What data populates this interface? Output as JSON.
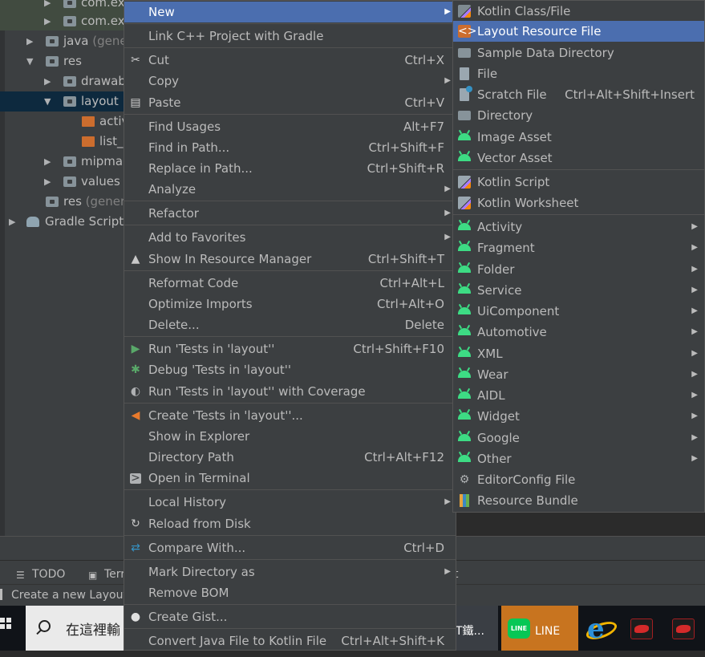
{
  "tree": {
    "items": [
      {
        "label": "com.exa",
        "hint": ""
      },
      {
        "label": "com.exa",
        "hint": ""
      },
      {
        "label": "java",
        "hint": "(gener"
      },
      {
        "label": "res",
        "hint": ""
      },
      {
        "label": "drawab",
        "hint": ""
      },
      {
        "label": "layout",
        "hint": ""
      },
      {
        "label": "activ",
        "hint": ""
      },
      {
        "label": "list_c",
        "hint": ""
      },
      {
        "label": "mipmap",
        "hint": ""
      },
      {
        "label": "values",
        "hint": ""
      },
      {
        "label": "res",
        "hint": "(genera"
      },
      {
        "label": "Gradle Scripts",
        "hint": ""
      }
    ]
  },
  "toolwindows": {
    "todo": "TODO",
    "terminal": "Terr",
    "right_fragment": "t"
  },
  "status": {
    "text": "Create a new Layout"
  },
  "taskbar": {
    "search_placeholder": "在這裡輸",
    "apps": [
      {
        "label": "T鐵..."
      },
      {
        "label": "LINE"
      }
    ]
  },
  "context_menu": {
    "items": [
      {
        "label": "New",
        "shortcut": "",
        "submenu": true,
        "icon": ""
      },
      {
        "label": "Link C++ Project with Gradle",
        "shortcut": "",
        "submenu": false,
        "icon": ""
      },
      {
        "label": "Cut",
        "shortcut": "Ctrl+X",
        "submenu": false,
        "icon": "scissors-icon"
      },
      {
        "label": "Copy",
        "shortcut": "",
        "submenu": true,
        "icon": ""
      },
      {
        "label": "Paste",
        "shortcut": "Ctrl+V",
        "submenu": false,
        "icon": "clipboard-icon"
      },
      {
        "label": "Find Usages",
        "shortcut": "Alt+F7",
        "submenu": false,
        "icon": ""
      },
      {
        "label": "Find in Path...",
        "shortcut": "Ctrl+Shift+F",
        "submenu": false,
        "icon": ""
      },
      {
        "label": "Replace in Path...",
        "shortcut": "Ctrl+Shift+R",
        "submenu": false,
        "icon": ""
      },
      {
        "label": "Analyze",
        "shortcut": "",
        "submenu": true,
        "icon": ""
      },
      {
        "label": "Refactor",
        "shortcut": "",
        "submenu": true,
        "icon": ""
      },
      {
        "label": "Add to Favorites",
        "shortcut": "",
        "submenu": true,
        "icon": ""
      },
      {
        "label": "Show In Resource Manager",
        "shortcut": "Ctrl+Shift+T",
        "submenu": false,
        "icon": "resource-manager-icon"
      },
      {
        "label": "Reformat Code",
        "shortcut": "Ctrl+Alt+L",
        "submenu": false,
        "icon": ""
      },
      {
        "label": "Optimize Imports",
        "shortcut": "Ctrl+Alt+O",
        "submenu": false,
        "icon": ""
      },
      {
        "label": "Delete...",
        "shortcut": "Delete",
        "submenu": false,
        "icon": ""
      },
      {
        "label": "Run 'Tests in 'layout''",
        "shortcut": "Ctrl+Shift+F10",
        "submenu": false,
        "icon": "run-icon"
      },
      {
        "label": "Debug 'Tests in 'layout''",
        "shortcut": "",
        "submenu": false,
        "icon": "debug-icon"
      },
      {
        "label": "Run 'Tests in 'layout'' with Coverage",
        "shortcut": "",
        "submenu": false,
        "icon": "coverage-icon"
      },
      {
        "label": "Create 'Tests in 'layout''...",
        "shortcut": "",
        "submenu": false,
        "icon": "create-test-icon"
      },
      {
        "label": "Show in Explorer",
        "shortcut": "",
        "submenu": false,
        "icon": ""
      },
      {
        "label": "Directory Path",
        "shortcut": "Ctrl+Alt+F12",
        "submenu": false,
        "icon": ""
      },
      {
        "label": "Open in Terminal",
        "shortcut": "",
        "submenu": false,
        "icon": "terminal-icon"
      },
      {
        "label": "Local History",
        "shortcut": "",
        "submenu": true,
        "icon": ""
      },
      {
        "label": "Reload from Disk",
        "shortcut": "",
        "submenu": false,
        "icon": "reload-icon"
      },
      {
        "label": "Compare With...",
        "shortcut": "Ctrl+D",
        "submenu": false,
        "icon": "compare-icon"
      },
      {
        "label": "Mark Directory as",
        "shortcut": "",
        "submenu": true,
        "icon": ""
      },
      {
        "label": "Remove BOM",
        "shortcut": "",
        "submenu": false,
        "icon": ""
      },
      {
        "label": "Create Gist...",
        "shortcut": "",
        "submenu": false,
        "icon": "github-icon"
      },
      {
        "label": "Convert Java File to Kotlin File",
        "shortcut": "Ctrl+Alt+Shift+K",
        "submenu": false,
        "icon": ""
      }
    ]
  },
  "new_submenu": {
    "items": [
      {
        "label": "Kotlin Class/File",
        "shortcut": "",
        "submenu": false,
        "icon": "kotlin-file-icon"
      },
      {
        "label": "Layout Resource File",
        "shortcut": "",
        "submenu": false,
        "icon": "layout-file-icon"
      },
      {
        "label": "Sample Data Directory",
        "shortcut": "",
        "submenu": false,
        "icon": "folder-icon"
      },
      {
        "label": "File",
        "shortcut": "",
        "submenu": false,
        "icon": "file-icon"
      },
      {
        "label": "Scratch File",
        "shortcut": "Ctrl+Alt+Shift+Insert",
        "submenu": false,
        "icon": "scratch-file-icon"
      },
      {
        "label": "Directory",
        "shortcut": "",
        "submenu": false,
        "icon": "folder-icon"
      },
      {
        "label": "Image Asset",
        "shortcut": "",
        "submenu": false,
        "icon": "android-icon"
      },
      {
        "label": "Vector Asset",
        "shortcut": "",
        "submenu": false,
        "icon": "android-icon"
      },
      {
        "label": "Kotlin Script",
        "shortcut": "",
        "submenu": false,
        "icon": "kotlin-script-icon"
      },
      {
        "label": "Kotlin Worksheet",
        "shortcut": "",
        "submenu": false,
        "icon": "kotlin-script-icon"
      },
      {
        "label": "Activity",
        "shortcut": "",
        "submenu": true,
        "icon": "android-icon"
      },
      {
        "label": "Fragment",
        "shortcut": "",
        "submenu": true,
        "icon": "android-icon"
      },
      {
        "label": "Folder",
        "shortcut": "",
        "submenu": true,
        "icon": "android-icon"
      },
      {
        "label": "Service",
        "shortcut": "",
        "submenu": true,
        "icon": "android-icon"
      },
      {
        "label": "UiComponent",
        "shortcut": "",
        "submenu": true,
        "icon": "android-icon"
      },
      {
        "label": "Automotive",
        "shortcut": "",
        "submenu": true,
        "icon": "android-icon"
      },
      {
        "label": "XML",
        "shortcut": "",
        "submenu": true,
        "icon": "android-icon"
      },
      {
        "label": "Wear",
        "shortcut": "",
        "submenu": true,
        "icon": "android-icon"
      },
      {
        "label": "AIDL",
        "shortcut": "",
        "submenu": true,
        "icon": "android-icon"
      },
      {
        "label": "Widget",
        "shortcut": "",
        "submenu": true,
        "icon": "android-icon"
      },
      {
        "label": "Google",
        "shortcut": "",
        "submenu": true,
        "icon": "android-icon"
      },
      {
        "label": "Other",
        "shortcut": "",
        "submenu": true,
        "icon": "android-icon"
      },
      {
        "label": "EditorConfig File",
        "shortcut": "",
        "submenu": false,
        "icon": "gear-icon"
      },
      {
        "label": "Resource Bundle",
        "shortcut": "",
        "submenu": false,
        "icon": "resource-bundle-icon"
      }
    ]
  },
  "colors": {
    "menu_bg": "#3c3f41",
    "highlight": "#4b6eaf",
    "android_green": "#3ddc84",
    "selection": "#0d293e"
  }
}
